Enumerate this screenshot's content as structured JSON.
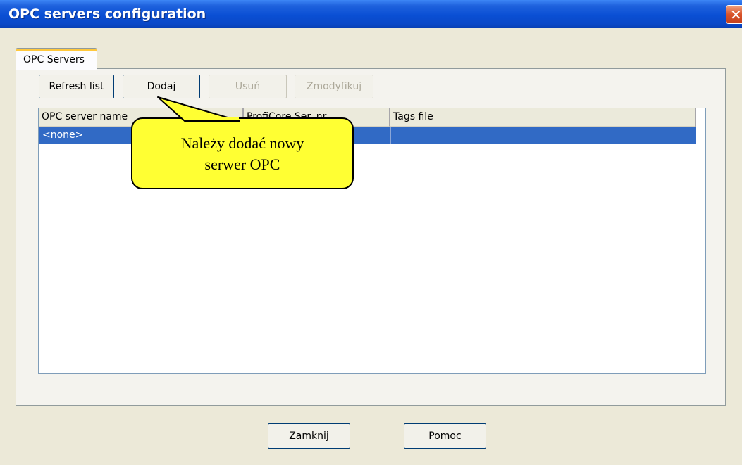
{
  "window": {
    "title": "OPC servers configuration",
    "close_glyph": "✕"
  },
  "tabs": [
    {
      "label": "OPC Servers",
      "active": true
    }
  ],
  "toolbar": {
    "refresh_label": "Refresh list",
    "add_label": "Dodaj",
    "remove_label": "Usuń",
    "modify_label": "Zmodyfikuj"
  },
  "table": {
    "columns": [
      "OPC server name",
      "ProfiCore Ser. nr",
      "Tags file"
    ],
    "rows": [
      {
        "name": "<none>",
        "serial": "",
        "tags_file": "",
        "selected": true
      }
    ]
  },
  "callout": {
    "line1": "Należy dodać nowy",
    "line2": "serwer OPC",
    "color": "#ffff33"
  },
  "footer": {
    "close_label": "Zamknij",
    "help_label": "Pomoc"
  },
  "colors": {
    "titlebar": "#0a4fd4",
    "selection": "#316ac5",
    "dialog": "#ece9d8"
  }
}
